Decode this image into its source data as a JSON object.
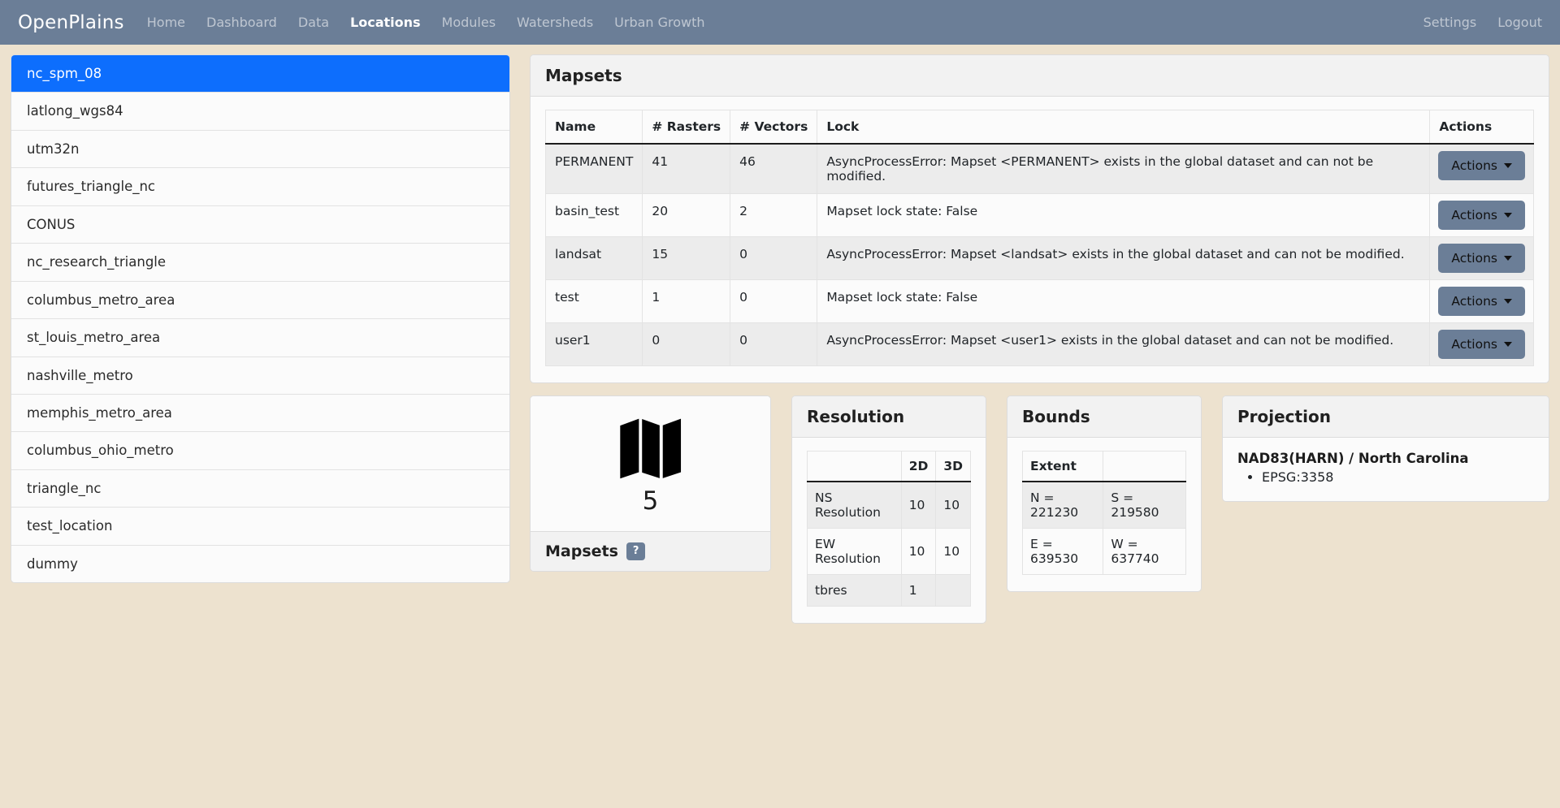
{
  "navbar": {
    "brand": "OpenPlains",
    "links": [
      {
        "label": "Home",
        "active": false
      },
      {
        "label": "Dashboard",
        "active": false
      },
      {
        "label": "Data",
        "active": false
      },
      {
        "label": "Locations",
        "active": true
      },
      {
        "label": "Modules",
        "active": false
      },
      {
        "label": "Watersheds",
        "active": false
      },
      {
        "label": "Urban Growth",
        "active": false
      }
    ],
    "right_links": [
      {
        "label": "Settings"
      },
      {
        "label": "Logout"
      }
    ],
    "bg_color": "#6b7e97"
  },
  "sidebar": {
    "items": [
      {
        "label": "nc_spm_08",
        "active": true
      },
      {
        "label": "latlong_wgs84",
        "active": false
      },
      {
        "label": "utm32n",
        "active": false
      },
      {
        "label": "futures_triangle_nc",
        "active": false
      },
      {
        "label": "CONUS",
        "active": false
      },
      {
        "label": "nc_research_triangle",
        "active": false
      },
      {
        "label": "columbus_metro_area",
        "active": false
      },
      {
        "label": "st_louis_metro_area",
        "active": false
      },
      {
        "label": "nashville_metro",
        "active": false
      },
      {
        "label": "memphis_metro_area",
        "active": false
      },
      {
        "label": "columbus_ohio_metro",
        "active": false
      },
      {
        "label": "triangle_nc",
        "active": false
      },
      {
        "label": "test_location",
        "active": false
      },
      {
        "label": "dummy",
        "active": false
      }
    ],
    "active_color": "#0d6efd"
  },
  "mapsets_card": {
    "title": "Mapsets",
    "columns": [
      "Name",
      "# Rasters",
      "# Vectors",
      "Lock",
      "Actions"
    ],
    "action_label": "Actions",
    "rows": [
      {
        "name": "PERMANENT",
        "rasters": "41",
        "vectors": "46",
        "lock": "AsyncProcessError: Mapset <PERMANENT> exists in the global dataset and can not be modified.",
        "action": "Actions"
      },
      {
        "name": "basin_test",
        "rasters": "20",
        "vectors": "2",
        "lock": "Mapset lock state: False",
        "action": "Actions"
      },
      {
        "name": "landsat",
        "rasters": "15",
        "vectors": "0",
        "lock": "AsyncProcessError: Mapset <landsat> exists in the global dataset and can not be modified.",
        "action": "Actions"
      },
      {
        "name": "test",
        "rasters": "1",
        "vectors": "0",
        "lock": "Mapset lock state: False",
        "action": "Actions"
      },
      {
        "name": "user1",
        "rasters": "0",
        "vectors": "0",
        "lock": "AsyncProcessError: Mapset <user1> exists in the global dataset and can not be modified.",
        "action": "Actions"
      }
    ]
  },
  "mapset_count_card": {
    "icon": "map-icon",
    "count": "5",
    "footer_label": "Mapsets",
    "help_badge": "?"
  },
  "resolution_card": {
    "title": "Resolution",
    "columns": [
      "",
      "2D",
      "3D"
    ],
    "rows": [
      {
        "label": "NS Resolution",
        "d2": "10",
        "d3": "10"
      },
      {
        "label": "EW Resolution",
        "d2": "10",
        "d3": "10"
      },
      {
        "label": "tbres",
        "d2": "1",
        "d3": ""
      }
    ]
  },
  "bounds_card": {
    "title": "Bounds",
    "columns": [
      "Extent",
      ""
    ],
    "rows": [
      {
        "left": "N = 221230",
        "right": "S = 219580"
      },
      {
        "left": "E = 639530",
        "right": "W = 637740"
      }
    ]
  },
  "projection_card": {
    "title": "Projection",
    "name": "NAD83(HARN) / North Carolina",
    "epsg": "EPSG:3358"
  }
}
